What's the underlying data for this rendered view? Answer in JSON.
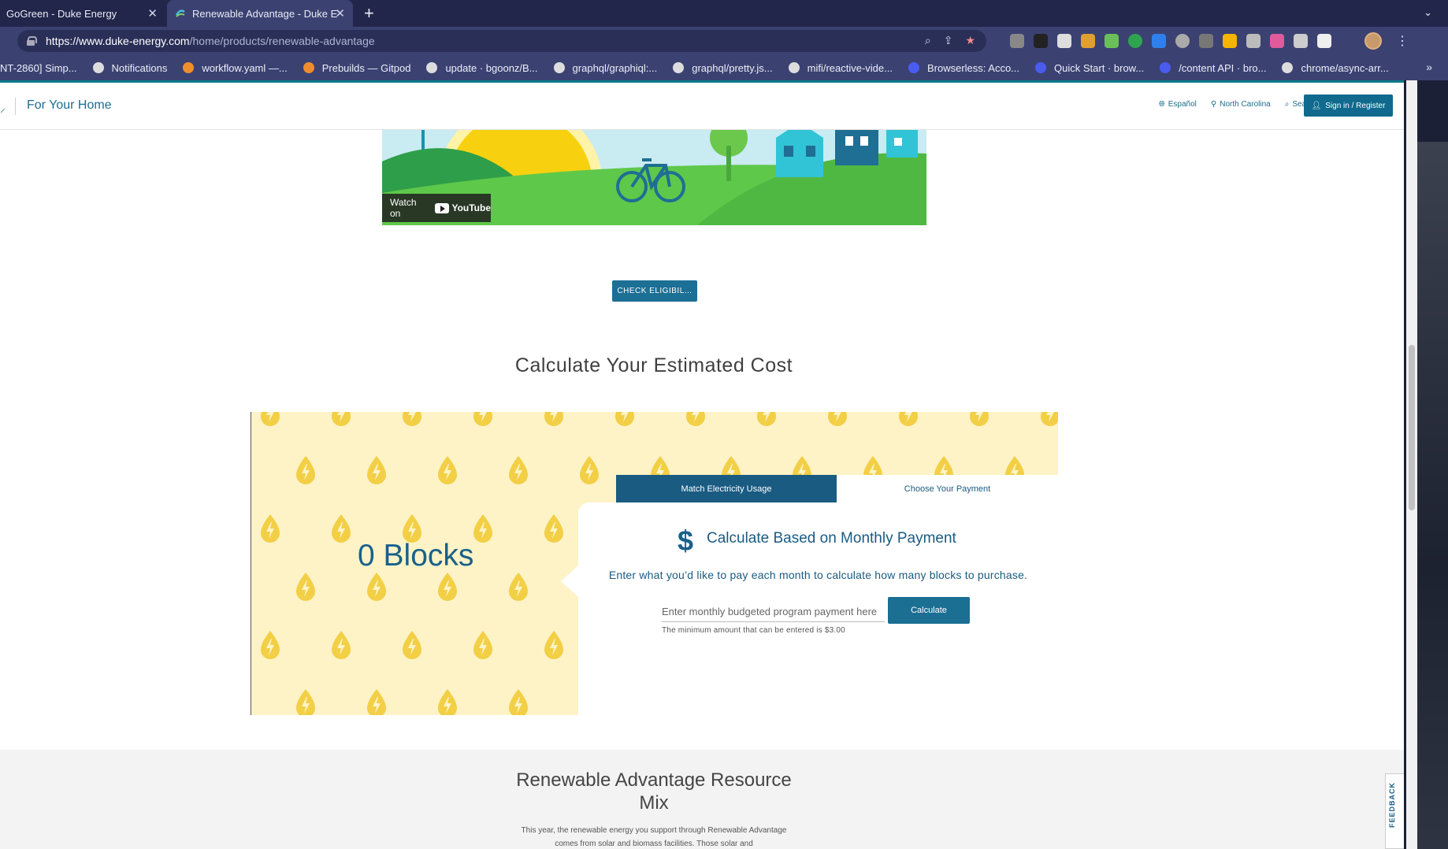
{
  "browser": {
    "tabs": [
      {
        "title": "GoGreen - Duke Energy",
        "active": false
      },
      {
        "title": "Renewable Advantage - Duke E",
        "active": true
      }
    ],
    "url_host": "https://www.duke-energy.com",
    "url_path": "/home/products/renewable-advantage",
    "bookmarks": [
      "NT-2860] Simp...",
      "Notifications",
      "workflow.yaml —...",
      "Prebuilds — Gitpod",
      "update · bgoonz/B...",
      "graphql/graphiql:...",
      "graphql/pretty.js...",
      "mifi/reactive-vide...",
      "Browserless: Acco...",
      "Quick Start · brow...",
      "/content API · bro...",
      "chrome/async-arr..."
    ]
  },
  "header": {
    "section_title": "For Your Home",
    "links": {
      "language": "Español",
      "location": "North Carolina",
      "search": "Search"
    },
    "signin_label": "Sign in / Register"
  },
  "video": {
    "watch_on": "Watch on",
    "youtube": "YouTube"
  },
  "check_eligibility_label": "CHECK ELIGIBIL...",
  "calculator": {
    "title": "Calculate Your Estimated Cost",
    "blocks_text": "0 Blocks",
    "tabs": {
      "match": "Match Electricity Usage",
      "payment": "Choose Your Payment"
    },
    "dollar_symbol": "$",
    "panel_title": "Calculate Based on Monthly Payment",
    "panel_subtitle": "Enter what you’d like to pay each month to calculate how many blocks to purchase.",
    "input_placeholder": "Enter monthly budgeted program payment here",
    "calculate_label": "Calculate",
    "min_note": "The minimum amount that can be entered is $3.00"
  },
  "mix": {
    "title": "Renewable Advantage Resource Mix",
    "text": "This year, the renewable energy you support through Renewable Advantage comes from solar and biomass facilities. Those solar and"
  },
  "feedback_label": "FEEDBACK",
  "colors": {
    "brand_blue": "#1a5b82",
    "button_blue": "#1c6f95",
    "pattern_bg": "#fdf3c7",
    "bolt_yellow": "#f2cf45"
  }
}
